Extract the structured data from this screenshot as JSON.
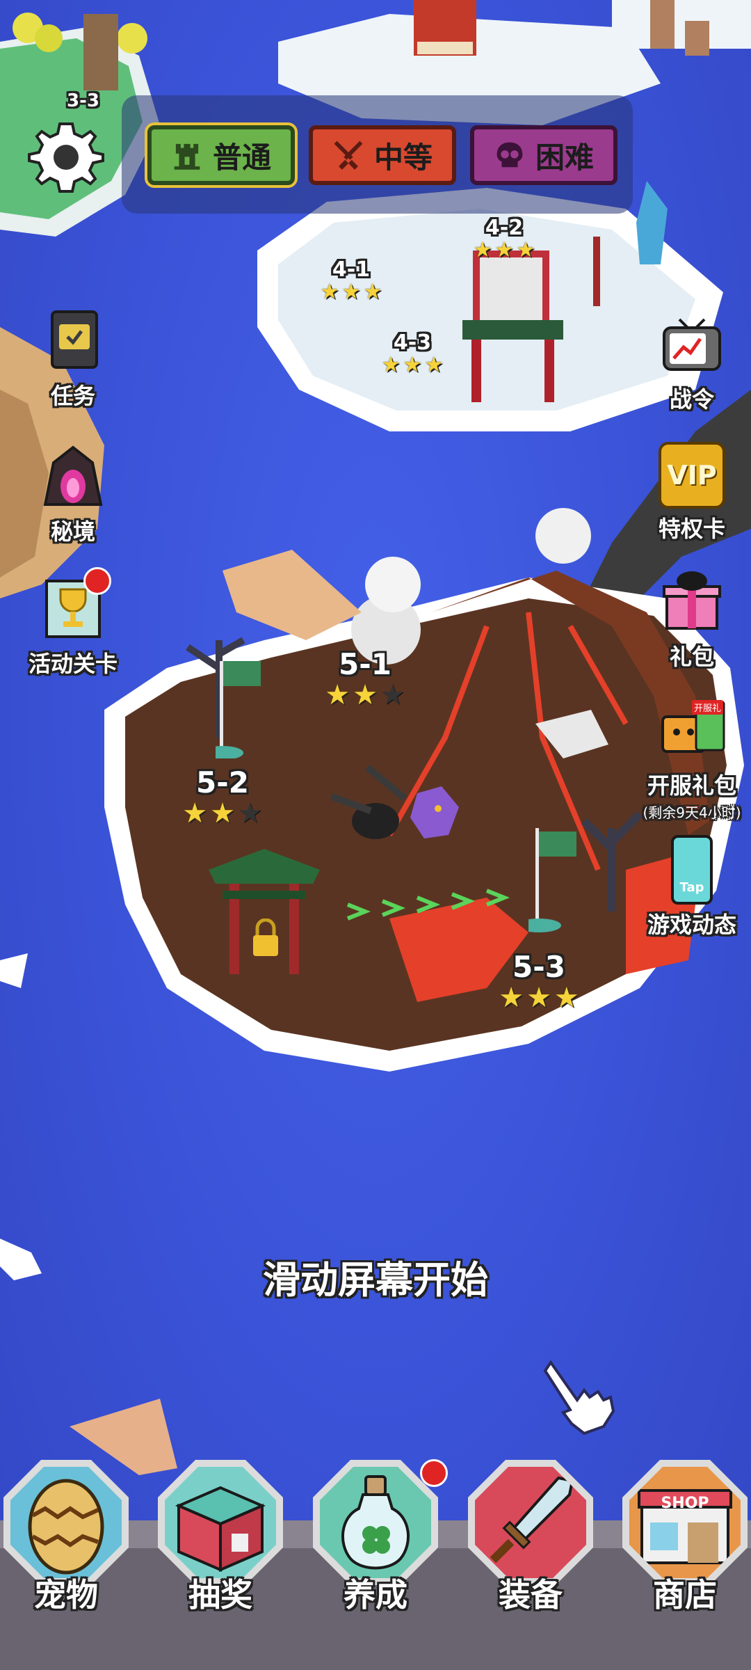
{
  "difficulty": {
    "normal": "普通",
    "medium": "中等",
    "hard": "困难"
  },
  "left_menu": {
    "quests": "任务",
    "secret_realm": "秘境",
    "event_stage": "活动关卡"
  },
  "right_menu": {
    "battle_pass": "战令",
    "vip_badge": "VIP",
    "privilege_card": "特权卡",
    "gift_pack": "礼包",
    "launch_gift": "开服礼包",
    "launch_gift_timer": "(剩余9天4小时)",
    "launch_gift_tag": "开服礼",
    "tap_icon_text": "Tap",
    "game_news": "游戏动态"
  },
  "levels": [
    {
      "id": "3-3",
      "stars": 0
    },
    {
      "id": "4-1",
      "stars": 3
    },
    {
      "id": "4-2",
      "stars": 3
    },
    {
      "id": "4-3",
      "stars": 3
    },
    {
      "id": "5-1",
      "stars": 2
    },
    {
      "id": "5-2",
      "stars": 2
    },
    {
      "id": "5-3",
      "stars": 3
    }
  ],
  "hint": "滑动屏幕开始",
  "bottom_nav": {
    "pets": "宠物",
    "lottery": "抽奖",
    "cultivate": "养成",
    "equipment": "装备",
    "shop": "商店",
    "shop_sign": "SHOP"
  },
  "colors": {
    "ocean": "#3a52d6",
    "normal": "#6bb34a",
    "medium": "#d8492f",
    "hard": "#9b3b8e",
    "lava_island": "#5a3422",
    "snow_island": "#eef4f8",
    "star_on": "#f7d33b"
  },
  "icons": [
    "gear-icon",
    "castle-icon",
    "swords-icon",
    "skull-icon",
    "book-icon",
    "cave-icon",
    "trophy-icon",
    "tv-chart-icon",
    "vip-icon",
    "gift-icon",
    "tap-icon",
    "egg-icon",
    "chest-icon",
    "potion-icon",
    "sword-icon",
    "shop-icon",
    "pointer-hand-icon",
    "flag-icon",
    "lock-icon"
  ]
}
